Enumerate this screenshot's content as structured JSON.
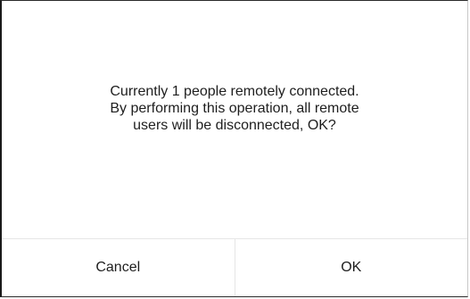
{
  "dialog": {
    "message_lines": [
      "Currently 1 people remotely connected.",
      "By performing this operation, all remote",
      "users will be disconnected, OK?"
    ],
    "cancel_label": "Cancel",
    "ok_label": "OK"
  }
}
